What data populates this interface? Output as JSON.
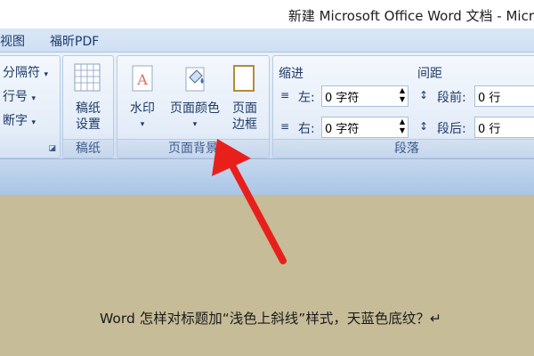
{
  "window": {
    "title": "新建 Microsoft Office Word 文档 - Micr"
  },
  "tabs": [
    {
      "label": "视图"
    },
    {
      "label": "福昕PDF"
    }
  ],
  "ribbon": {
    "page_setup": {
      "items": [
        "分隔符",
        "行号",
        "断字"
      ]
    },
    "manuscript": {
      "button": "稿纸\n设置",
      "line1": "稿纸",
      "line2": "设置",
      "footer": "稿纸"
    },
    "page_background": {
      "watermark": "水印",
      "page_color": "页面颜色",
      "page_border_1": "页面",
      "page_border_2": "边框",
      "footer": "页面背景"
    },
    "paragraph": {
      "indent_title": "缩进",
      "spacing_title": "间距",
      "left_label": "左:",
      "right_label": "右:",
      "before_label": "段前:",
      "after_label": "段后:",
      "left_value": "0 字符",
      "right_value": "0 字符",
      "before_value": "0 行",
      "after_value": "0 行",
      "footer": "段落"
    }
  },
  "document": {
    "text": "Word 怎样对标题加“浅色上斜线”样式，天蓝色底纹？↵"
  },
  "colors": {
    "arrow": "#e8201b",
    "ribbon_bg": "#dde8f6",
    "doc_bg": "#c6bc98"
  }
}
